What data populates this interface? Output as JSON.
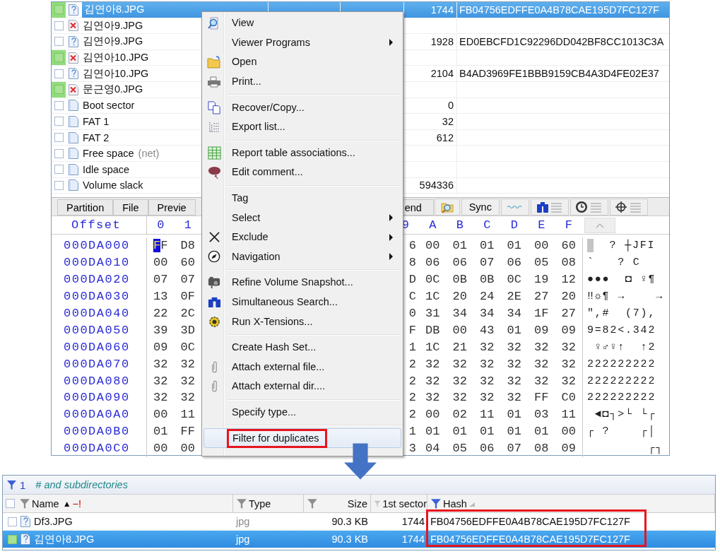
{
  "file_list": {
    "rows": [
      {
        "name": "김연아8.JPG",
        "kind": "unknown",
        "tagged": true,
        "selected": true,
        "first_sector": "1744",
        "hash": "FB04756EDFFE0A4B78CAE195D7FC127F"
      },
      {
        "name": "김연아9.JPG",
        "kind": "deleted",
        "tagged": false,
        "selected": false
      },
      {
        "name": "김연아9.JPG",
        "kind": "unknown",
        "tagged": false,
        "selected": false,
        "first_sector": "1928",
        "hash": "ED0EBCFD1C92296DD042BF8CC1013C3A"
      },
      {
        "name": "김연아10.JPG",
        "kind": "deleted",
        "tagged": true,
        "selected": false
      },
      {
        "name": "김연아10.JPG",
        "kind": "unknown",
        "tagged": false,
        "selected": false,
        "first_sector": "2104",
        "hash": "B4AD3969FE1BBB9159CB4A3D4FE02E37"
      },
      {
        "name": "문근영0.JPG",
        "kind": "deleted",
        "tagged": true,
        "selected": false
      },
      {
        "name": "Boot sector",
        "kind": "document",
        "tagged": false,
        "selected": false,
        "first_sector": "0"
      },
      {
        "name": "FAT 1",
        "kind": "document",
        "tagged": false,
        "selected": false,
        "first_sector": "32"
      },
      {
        "name": "FAT 2",
        "kind": "document",
        "tagged": false,
        "selected": false,
        "first_sector": "612"
      },
      {
        "name": "Free space",
        "note": "(net)",
        "kind": "document",
        "tagged": false,
        "selected": false
      },
      {
        "name": "Idle space",
        "kind": "document",
        "tagged": false,
        "selected": false
      },
      {
        "name": "Volume slack",
        "kind": "document",
        "tagged": false,
        "selected": false,
        "first_sector": "594336"
      }
    ]
  },
  "hex_toolbar": {
    "tabs": [
      {
        "label": "Partition",
        "selected": false
      },
      {
        "label": "File",
        "selected": false
      },
      {
        "label": "Previe",
        "selected": false
      },
      {
        "label": "end",
        "selected": false
      }
    ],
    "sync_label": "Sync"
  },
  "hex_view": {
    "offset_label": "Offset",
    "columns": [
      "0",
      "1",
      "9",
      "A",
      "B",
      "C",
      "D",
      "E",
      "F"
    ],
    "rows": [
      {
        "offset": "000DA000",
        "bytes": [
          "FF",
          "D8",
          "6",
          "00",
          "01",
          "01",
          "01",
          "00",
          "60"
        ],
        "ascii": "  ? ┼JFI",
        "cursor": true
      },
      {
        "offset": "000DA010",
        "bytes": [
          "00",
          "60",
          "8",
          "06",
          "06",
          "07",
          "06",
          "05",
          "08"
        ],
        "ascii": "`   ? C",
        "cursor": false
      },
      {
        "offset": "000DA020",
        "bytes": [
          "07",
          "07",
          "D",
          "0C",
          "0B",
          "0B",
          "0C",
          "19",
          "12"
        ],
        "ascii": "●●●  ◘ ♀¶",
        "cursor": false
      },
      {
        "offset": "000DA030",
        "bytes": [
          "13",
          "0F",
          "C",
          "1C",
          "20",
          "24",
          "2E",
          "27",
          "20"
        ],
        "ascii": "‼☼¶ →    →",
        "cursor": false
      },
      {
        "offset": "000DA040",
        "bytes": [
          "22",
          "2C",
          "0",
          "31",
          "34",
          "34",
          "34",
          "1F",
          "27"
        ],
        "ascii": "\",#  (7),",
        "cursor": false
      },
      {
        "offset": "000DA050",
        "bytes": [
          "39",
          "3D",
          "F",
          "DB",
          "00",
          "43",
          "01",
          "09",
          "09"
        ],
        "ascii": "9=82<.342",
        "cursor": false
      },
      {
        "offset": "000DA060",
        "bytes": [
          "09",
          "0C",
          "1",
          "1C",
          "21",
          "32",
          "32",
          "32",
          "32"
        ],
        "ascii": " ♀♂♀↑  ↑2",
        "cursor": false
      },
      {
        "offset": "000DA070",
        "bytes": [
          "32",
          "32",
          "2",
          "32",
          "32",
          "32",
          "32",
          "32",
          "32"
        ],
        "ascii": "222222222",
        "cursor": false
      },
      {
        "offset": "000DA080",
        "bytes": [
          "32",
          "32",
          "2",
          "32",
          "32",
          "32",
          "32",
          "32",
          "32"
        ],
        "ascii": "222222222",
        "cursor": false
      },
      {
        "offset": "000DA090",
        "bytes": [
          "32",
          "32",
          "2",
          "32",
          "32",
          "32",
          "32",
          "FF",
          "C0"
        ],
        "ascii": "222222222",
        "cursor": false
      },
      {
        "offset": "000DA0A0",
        "bytes": [
          "00",
          "11",
          "2",
          "00",
          "02",
          "11",
          "01",
          "03",
          "11"
        ],
        "ascii": " ◄◘┐>└ └┌",
        "cursor": false
      },
      {
        "offset": "000DA0B0",
        "bytes": [
          "01",
          "FF",
          "1",
          "01",
          "01",
          "01",
          "01",
          "01",
          "00"
        ],
        "ascii": "┌ ?    ┌│",
        "cursor": false
      },
      {
        "offset": "000DA0C0",
        "bytes": [
          "00",
          "00",
          "3",
          "04",
          "05",
          "06",
          "07",
          "08",
          "09"
        ],
        "ascii": "        ┌┐",
        "cursor": false
      }
    ]
  },
  "context_menu": {
    "items": [
      {
        "kind": "item",
        "label": "View",
        "submenu": false,
        "highlighted": false
      },
      {
        "kind": "item",
        "label": "Viewer Programs",
        "submenu": true,
        "highlighted": false
      },
      {
        "kind": "item",
        "label": "Open",
        "submenu": false,
        "highlighted": false
      },
      {
        "kind": "item",
        "label": "Print...",
        "submenu": false,
        "highlighted": false
      },
      {
        "kind": "separator"
      },
      {
        "kind": "item",
        "label": "Recover/Copy...",
        "submenu": false,
        "highlighted": false
      },
      {
        "kind": "item",
        "label": "Export list...",
        "submenu": false,
        "highlighted": false
      },
      {
        "kind": "separator"
      },
      {
        "kind": "item",
        "label": "Report table associations...",
        "submenu": false,
        "highlighted": false
      },
      {
        "kind": "item",
        "label": "Edit comment...",
        "submenu": false,
        "highlighted": false
      },
      {
        "kind": "separator"
      },
      {
        "kind": "item",
        "label": "Tag",
        "submenu": false,
        "highlighted": false
      },
      {
        "kind": "item",
        "label": "Select",
        "submenu": true,
        "highlighted": false
      },
      {
        "kind": "item",
        "label": "Exclude",
        "submenu": true,
        "highlighted": false
      },
      {
        "kind": "item",
        "label": "Navigation",
        "submenu": true,
        "highlighted": false
      },
      {
        "kind": "separator"
      },
      {
        "kind": "item",
        "label": "Refine Volume Snapshot...",
        "submenu": false,
        "highlighted": false
      },
      {
        "kind": "item",
        "label": "Simultaneous Search...",
        "submenu": false,
        "highlighted": false
      },
      {
        "kind": "item",
        "label": "Run X-Tensions...",
        "submenu": false,
        "highlighted": false
      },
      {
        "kind": "separator"
      },
      {
        "kind": "item",
        "label": "Create Hash Set...",
        "submenu": false,
        "highlighted": false
      },
      {
        "kind": "item",
        "label": "Attach external file...",
        "submenu": false,
        "highlighted": false
      },
      {
        "kind": "item",
        "label": "Attach external dir....",
        "submenu": false,
        "highlighted": false
      },
      {
        "kind": "separator"
      },
      {
        "kind": "item",
        "label": "Specify type...",
        "submenu": false,
        "highlighted": false
      },
      {
        "kind": "separator"
      },
      {
        "kind": "item",
        "label": "Filter for duplicates",
        "submenu": false,
        "highlighted": true
      }
    ]
  },
  "result_panel": {
    "filter_count": "1",
    "filter_scope": "# and subdirectories",
    "columns": [
      {
        "label": "Name",
        "sort_mark": "▲",
        "flag": "−!",
        "filter_active": false
      },
      {
        "label": "Type",
        "filter_active": false
      },
      {
        "label": "Size",
        "filter_active": false
      },
      {
        "label": "1st sector",
        "filter_active": false
      },
      {
        "label": "Hash",
        "filter_active": true
      }
    ],
    "hash_outlined": true,
    "rows": [
      {
        "name": "Df3.JPG",
        "type": "jpg",
        "size": "90.3 KB",
        "first_sector": "1744",
        "hash": "FB04756EDFFE0A4B78CAE195D7FC127F",
        "tagged": false,
        "selected": false
      },
      {
        "name": "김연아8.JPG",
        "type": "jpg",
        "size": "90.3 KB",
        "first_sector": "1744",
        "hash": "FB04756EDFFE0A4B78CAE195D7FC127F",
        "tagged": true,
        "selected": true
      }
    ]
  }
}
